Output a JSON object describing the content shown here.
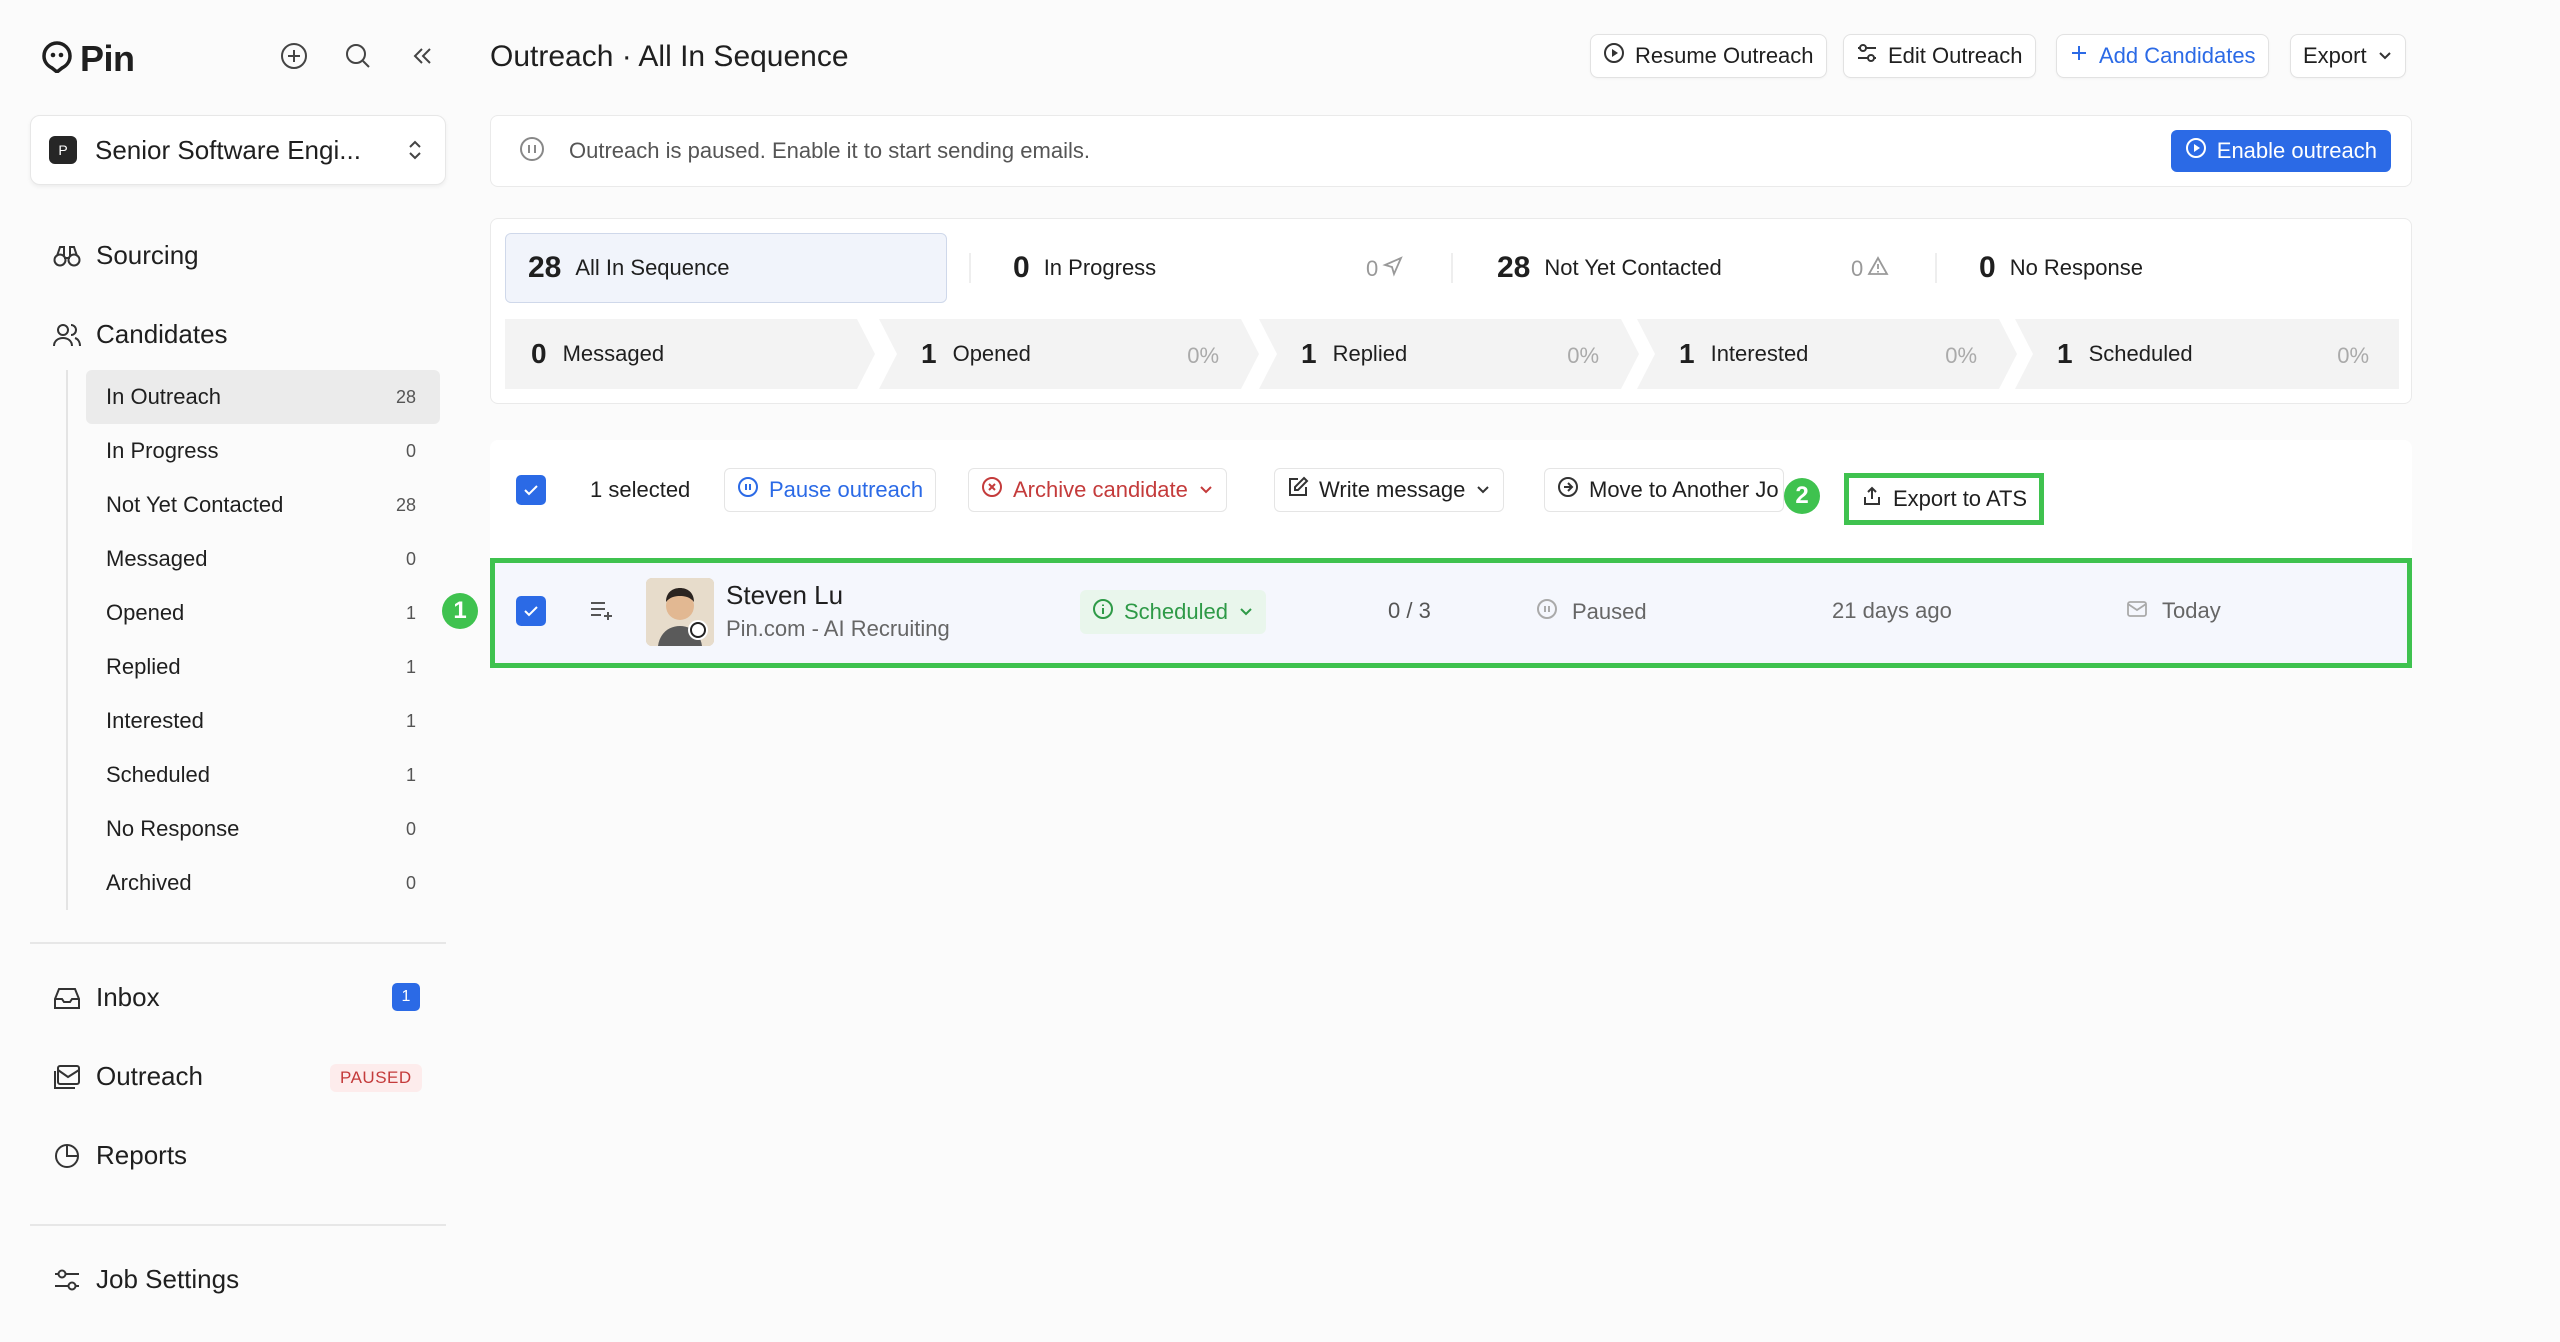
{
  "app": {
    "logo_text": "Pin"
  },
  "sidebar": {
    "job_badge": "P",
    "job_name": "Senior Software Engi...",
    "main_nav": {
      "sourcing": "Sourcing",
      "candidates": "Candidates"
    },
    "sub_items": [
      {
        "label": "In Outreach",
        "count": "28"
      },
      {
        "label": "In Progress",
        "count": "0"
      },
      {
        "label": "Not Yet Contacted",
        "count": "28"
      },
      {
        "label": "Messaged",
        "count": "0"
      },
      {
        "label": "Opened",
        "count": "1"
      },
      {
        "label": "Replied",
        "count": "1"
      },
      {
        "label": "Interested",
        "count": "1"
      },
      {
        "label": "Scheduled",
        "count": "1"
      },
      {
        "label": "No Response",
        "count": "0"
      },
      {
        "label": "Archived",
        "count": "0"
      }
    ],
    "inbox": {
      "label": "Inbox",
      "count": "1"
    },
    "outreach": {
      "label": "Outreach",
      "badge": "PAUSED"
    },
    "reports": {
      "label": "Reports"
    },
    "job_settings": {
      "label": "Job Settings"
    }
  },
  "header": {
    "title": "Outreach · All In Sequence",
    "resume": "Resume Outreach",
    "edit": "Edit Outreach",
    "add": "Add Candidates",
    "export": "Export"
  },
  "banner": {
    "text": "Outreach is paused. Enable it to start sending emails.",
    "enable": "Enable outreach"
  },
  "stats": {
    "top": [
      {
        "num": "28",
        "label": "All In Sequence",
        "side": ""
      },
      {
        "num": "0",
        "label": "In Progress",
        "side": "0"
      },
      {
        "num": "28",
        "label": "Not Yet Contacted",
        "side": "0"
      },
      {
        "num": "0",
        "label": "No Response",
        "side": ""
      }
    ],
    "funnel": [
      {
        "num": "0",
        "label": "Messaged",
        "pct": ""
      },
      {
        "num": "1",
        "label": "Opened",
        "pct": "0%"
      },
      {
        "num": "1",
        "label": "Replied",
        "pct": "0%"
      },
      {
        "num": "1",
        "label": "Interested",
        "pct": "0%"
      },
      {
        "num": "1",
        "label": "Scheduled",
        "pct": "0%"
      }
    ]
  },
  "bulk": {
    "selected": "1 selected",
    "pause": "Pause outreach",
    "archive": "Archive candidate",
    "write": "Write message",
    "move": "Move to Another Jo",
    "export_ats": "Export to ATS"
  },
  "row": {
    "name": "Steven Lu",
    "company": "Pin.com - AI Recruiting",
    "status": "Scheduled",
    "progress": "0 / 3",
    "state": "Paused",
    "added": "21 days ago",
    "last": "Today"
  },
  "markers": {
    "one": "1",
    "two": "2"
  },
  "colors": {
    "accent": "#2b6ae6",
    "highlight": "#3fc24f",
    "paused": "#c43b3b",
    "scheduled": "#2e9a47"
  }
}
